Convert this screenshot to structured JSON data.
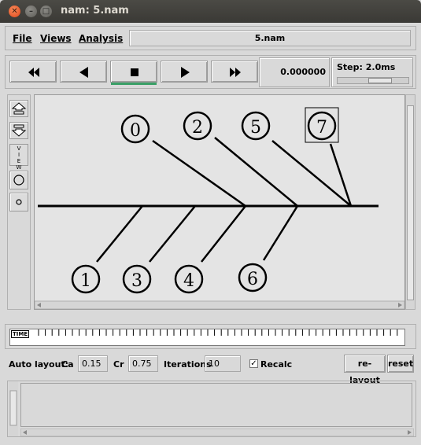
{
  "window": {
    "title": "nam: 5.nam"
  },
  "menu": {
    "file": "File",
    "views": "Views",
    "analysis": "Analysis",
    "filename": "5.nam"
  },
  "toolbar": {
    "buttons": [
      {
        "name": "rewind-button",
        "icon": "fast-backward-icon"
      },
      {
        "name": "play-backward-button",
        "icon": "play-backward-icon"
      },
      {
        "name": "stop-button",
        "icon": "stop-icon"
      },
      {
        "name": "play-forward-button",
        "icon": "play-forward-icon"
      },
      {
        "name": "fast-forward-button",
        "icon": "fast-forward-icon"
      }
    ],
    "time": "0.000000",
    "step_label": "Step: 2.0ms",
    "step_fraction": 0.65,
    "active_color": "#3aa067"
  },
  "left_tools": {
    "view_text": [
      "V",
      "I",
      "E",
      "W"
    ]
  },
  "topology": {
    "nodes": [
      {
        "label": "0",
        "shape": "circle"
      },
      {
        "label": "2",
        "shape": "circle"
      },
      {
        "label": "5",
        "shape": "circle"
      },
      {
        "label": "7",
        "shape": "square"
      },
      {
        "label": "1",
        "shape": "circle"
      },
      {
        "label": "3",
        "shape": "circle"
      },
      {
        "label": "4",
        "shape": "circle"
      },
      {
        "label": "6",
        "shape": "circle"
      }
    ]
  },
  "timeline": {
    "tag": "TIME"
  },
  "auto_layout": {
    "label": "Auto layout:",
    "ca_label": "Ca",
    "ca_value": "0.15",
    "cr_label": "Cr",
    "cr_value": "0.75",
    "iterations_label": "Iterations",
    "iterations_value": "10",
    "recalc_label": "Recalc",
    "recalc_checked": true,
    "relayout_label": "re-layout",
    "reset_label": "reset"
  }
}
